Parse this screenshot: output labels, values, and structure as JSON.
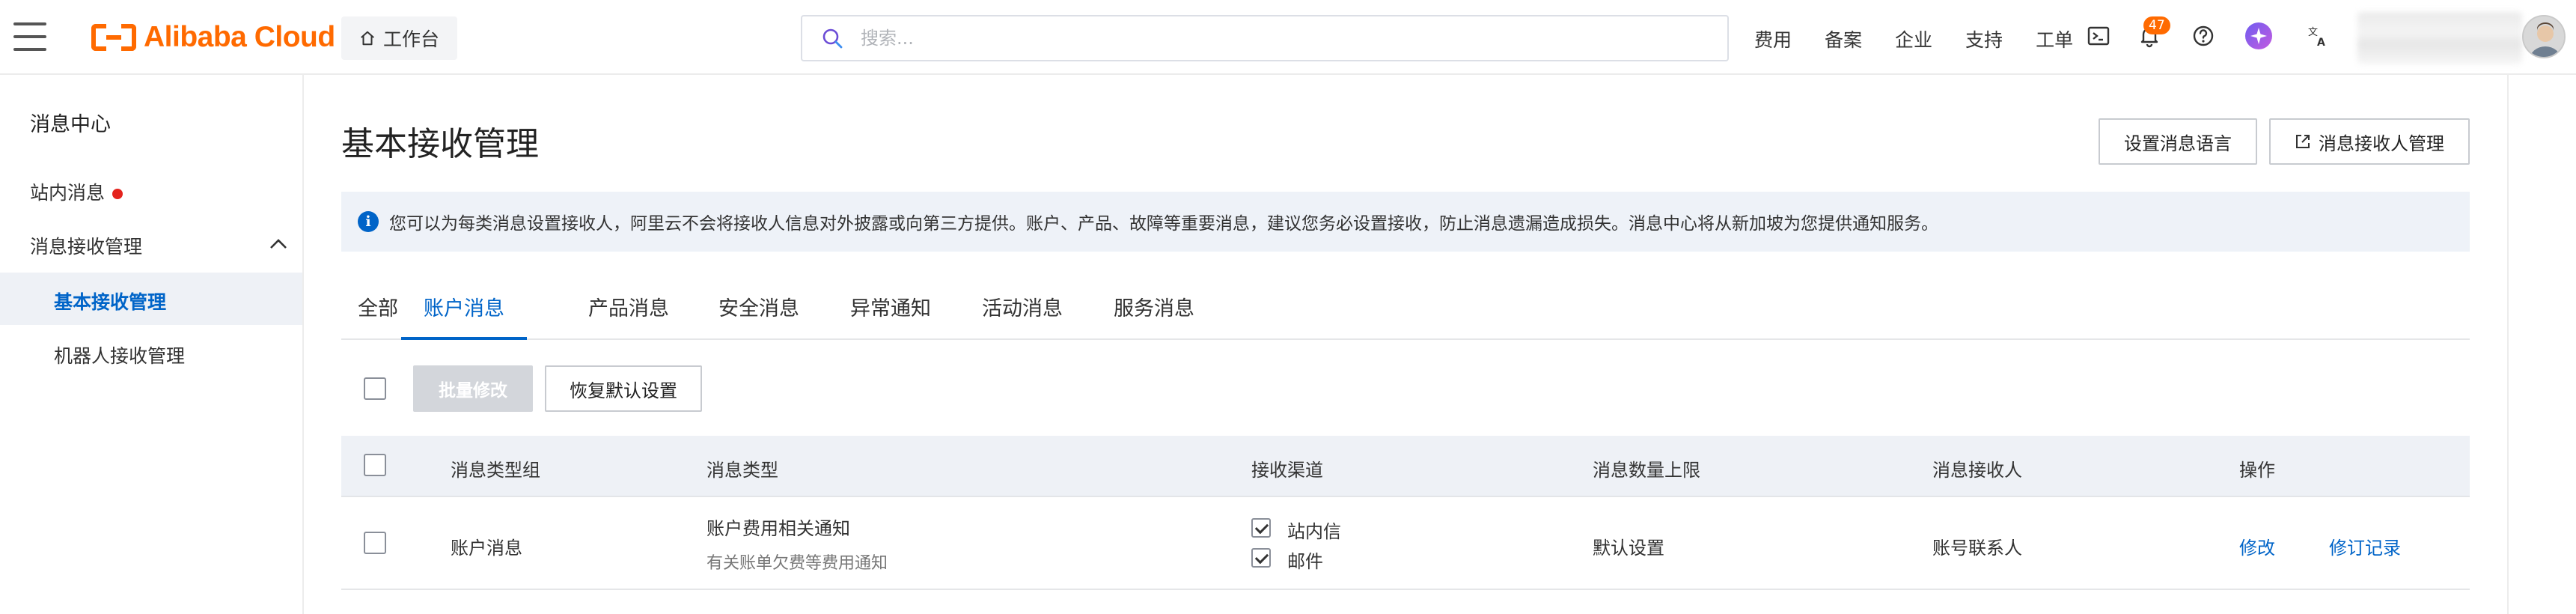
{
  "header": {
    "logo_text": "Alibaba Cloud",
    "workbench_label": "工作台",
    "search_placeholder": "搜索...",
    "nav": [
      "费用",
      "备案",
      "企业",
      "支持",
      "工单"
    ],
    "notification_count": "47",
    "brand_color": "#ff6a00"
  },
  "sidebar": {
    "title": "消息中心",
    "items": [
      {
        "label": "站内消息",
        "has_dot": true
      },
      {
        "label": "消息接收管理",
        "expanded": true
      }
    ],
    "sub_items": [
      {
        "label": "基本接收管理",
        "active": true
      },
      {
        "label": "机器人接收管理",
        "active": false
      }
    ]
  },
  "main": {
    "title": "基本接收管理",
    "buttons": {
      "set_language": "设置消息语言",
      "receiver_management": "消息接收人管理"
    },
    "notice": "您可以为每类消息设置接收人，阿里云不会将接收人信息对外披露或向第三方提供。账户、产品、故障等重要消息，建议您务必设置接收，防止消息遗漏造成损失。消息中心将从新加坡为您提供通知服务。",
    "tabs": [
      {
        "label": "全部",
        "active": false
      },
      {
        "label": "账户消息",
        "active": true
      },
      {
        "label": "产品消息",
        "active": false
      },
      {
        "label": "安全消息",
        "active": false
      },
      {
        "label": "异常通知",
        "active": false
      },
      {
        "label": "活动消息",
        "active": false
      },
      {
        "label": "服务消息",
        "active": false
      }
    ],
    "toolbar": {
      "batch_edit": "批量修改",
      "restore_default": "恢复默认设置"
    },
    "table": {
      "columns": [
        "消息类型组",
        "消息类型",
        "接收渠道",
        "消息数量上限",
        "消息接收人",
        "操作"
      ],
      "rows": [
        {
          "group": "账户消息",
          "type": "账户费用相关通知",
          "type_desc": "有关账单欠费等费用通知",
          "channels": [
            {
              "label": "站内信",
              "checked": true
            },
            {
              "label": "邮件",
              "checked": true
            }
          ],
          "limit": "默认设置",
          "receiver": "账号联系人",
          "actions": [
            "修改",
            "修订记录"
          ]
        }
      ]
    },
    "accent_color": "#0064c8"
  }
}
